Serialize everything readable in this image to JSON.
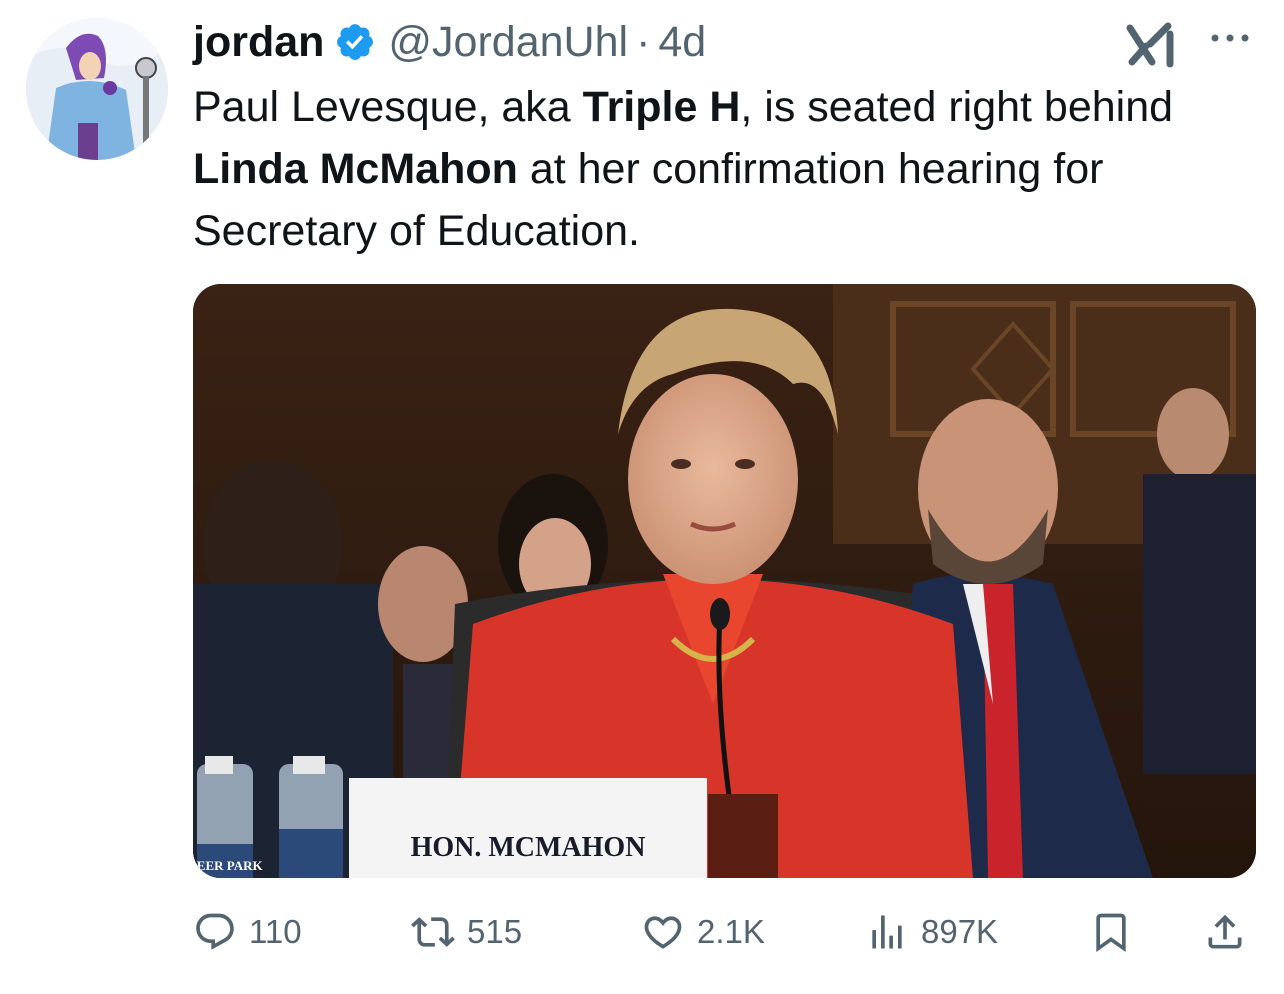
{
  "tweet": {
    "author": {
      "display_name": "jordan",
      "handle": "@JordanUhl",
      "verified": true,
      "avatar_icon": "cartoon-avatar-icon"
    },
    "separator": "·",
    "timestamp": "4d",
    "text": {
      "p1": "Paul Levesque, aka ",
      "b1": "Triple H",
      "p2": ", is seated right behind ",
      "b2": "Linda McMahon",
      "p3": " at her confirmation hearing for Secretary of Education."
    },
    "media": {
      "name_placard": "HON. MCMAHON",
      "bottle_label": "DEER PARK"
    },
    "actions": {
      "replies": "110",
      "reposts": "515",
      "likes": "2.1K",
      "views": "897K"
    }
  },
  "colors": {
    "text": "#0f1419",
    "secondary": "#536471",
    "verified": "#1d9bf0"
  }
}
